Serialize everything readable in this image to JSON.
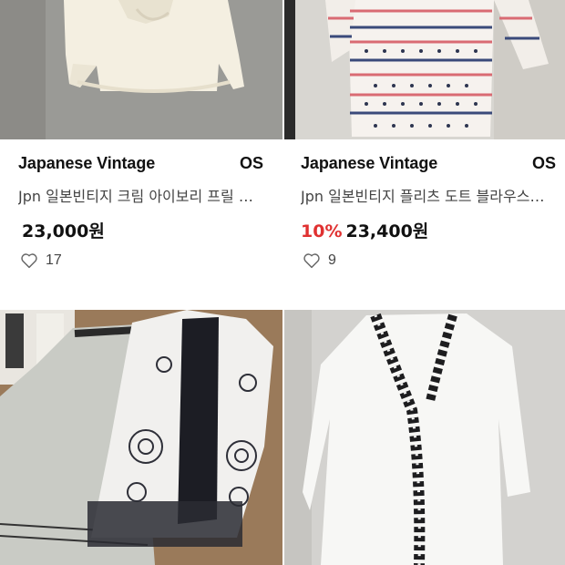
{
  "products": [
    {
      "brand": "Japanese Vintage",
      "size": "OS",
      "title": "Jpn 일본빈티지 크림 아이보리 프릴 블라우스",
      "discount": "",
      "price": "23,000원",
      "likes": "17",
      "image_icon": "cream-blouse-photo"
    },
    {
      "brand": "Japanese Vintage",
      "size": "OS",
      "title": "Jpn 일본빈티지 플리츠 도트 블라우스 원피스",
      "discount": "10%",
      "price": "23,400원",
      "likes": "9",
      "image_icon": "striped-dot-dress-photo"
    },
    {
      "image_icon": "lace-dress-skirt-photo"
    },
    {
      "image_icon": "white-ruffle-blouse-photo"
    }
  ],
  "colors": {
    "discount": "#e03131",
    "text": "#111111",
    "muted": "#444444"
  }
}
